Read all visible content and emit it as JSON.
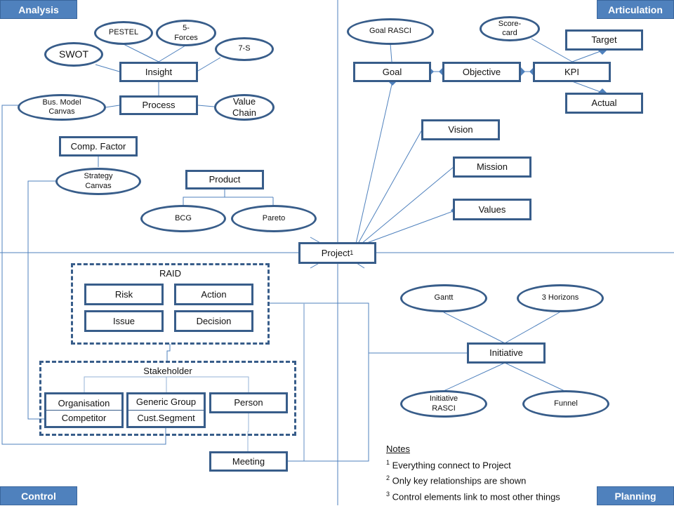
{
  "quadrants": {
    "analysis": "Analysis",
    "articulation": "Articulation",
    "control": "Control",
    "planning": "Planning"
  },
  "colors": {
    "node_border": "#385d8a",
    "connector": "#4f81bd",
    "label_fill": "#4f81bd"
  },
  "center": {
    "label": "Project",
    "footnote": "1"
  },
  "analysis": {
    "insight": "Insight",
    "process": "Process",
    "swot": "SWOT",
    "pestel": "PESTEL",
    "five_forces": "5-\nForces",
    "seven_s": "7-S",
    "bus_model_canvas": "Bus. Model Canvas",
    "value_chain": "Value Chain",
    "comp_factor": "Comp. Factor",
    "strategy_canvas": "Strategy Canvas",
    "product": "Product",
    "bcg": "BCG",
    "pareto": "Pareto"
  },
  "articulation": {
    "goal_rasci": "Goal RASCI",
    "scorecard": "Score-card",
    "target": "Target",
    "goal": "Goal",
    "objective": "Objective",
    "kpi": "KPI",
    "actual": "Actual",
    "vision": "Vision",
    "mission": "Mission",
    "values": "Values"
  },
  "control": {
    "raid_title": "RAID",
    "risk": "Risk",
    "action": "Action",
    "issue": "Issue",
    "decision": "Decision",
    "stakeholder_title": "Stakeholder",
    "organisation": "Organisation",
    "competitor": "Competitor",
    "generic_group": "Generic Group",
    "cust_segment": "Cust.Segment",
    "person": "Person",
    "meeting": "Meeting"
  },
  "planning": {
    "gantt": "Gantt",
    "three_horizons": "3 Horizons",
    "initiative": "Initiative",
    "initiative_rasci": "Initiative RASCI",
    "funnel": "Funnel"
  },
  "notes": {
    "title": "Notes",
    "items": [
      {
        "mark": "1",
        "text": "Everything connect to Project"
      },
      {
        "mark": "2",
        "text": "Only key relationships are shown"
      },
      {
        "mark": "3",
        "text": "Control elements link to most other things"
      }
    ]
  }
}
